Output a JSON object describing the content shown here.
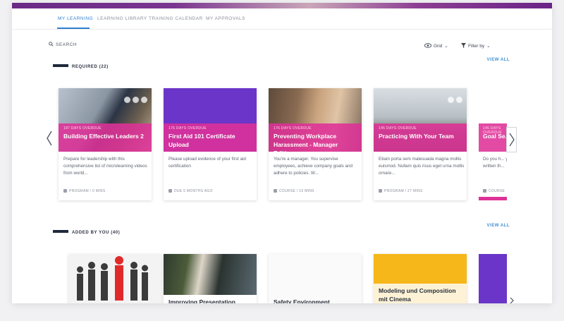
{
  "tabs": [
    {
      "label": "MY LEARNING",
      "active": true
    },
    {
      "label": "LEARNING LIBRARY",
      "active": false
    },
    {
      "label": "TRAINING CALENDAR",
      "active": false
    },
    {
      "label": "MY APPROVALS",
      "active": false
    }
  ],
  "search": {
    "label": "SEARCH"
  },
  "view": {
    "grid_label": "Grid",
    "filter_label": "Filter by"
  },
  "sections": {
    "required": {
      "label": "REQUIRED (22)",
      "view_all": "VIEW ALL"
    },
    "added": {
      "label": "ADDED BY YOU (40)",
      "view_all": "VIEW ALL"
    }
  },
  "required_cards": [
    {
      "overdue": "187 DAYS OVERDUE",
      "title": "Building Effective Leaders 2",
      "desc": "Prepare for leadership with this comprehensive list of microlearning videos from world...",
      "meta": "PROGRAM / 0 MINS"
    },
    {
      "overdue": "176 DAYS OVERDUE",
      "title": "First Aid 101 Certificate Upload",
      "desc": "Please upload evidence of your first aid certification",
      "meta": "DUE 5 MONTHS AGO"
    },
    {
      "overdue": "176 DAYS OVERDUE",
      "title": "Preventing Workplace Harassment - Manager Edition",
      "desc": "You're a manager. You supervise employees, achieve company goals and adhere to policies. W...",
      "meta": "COURSE / 15 MINS"
    },
    {
      "overdue": "145 DAYS OVERDUE",
      "title": "Practicing With Your Team",
      "desc": "Etiam porta sem malesuada magna mollis euismod. Nullam quis risus eget urna mollis ornare...",
      "meta": "PROGRAM / 27 MINS"
    },
    {
      "overdue": "145 DAYS OVERDUE",
      "title": "Goal Se... Achiev...",
      "desc": "Do you h... your t... written th...",
      "meta": "COURSE"
    }
  ],
  "added_cards": [
    {
      "title": ""
    },
    {
      "title": "Improving Presentation"
    },
    {
      "title": "Safety Environment"
    },
    {
      "title": "Modeling und Composition mit Cinema"
    },
    {
      "title": ""
    }
  ],
  "colors": {
    "accent": "#2f7fd0",
    "overdue_band": "#de3197",
    "purple": "#6b35c9",
    "yellow": "#f5b71a",
    "topbar": "#6a2a86"
  }
}
